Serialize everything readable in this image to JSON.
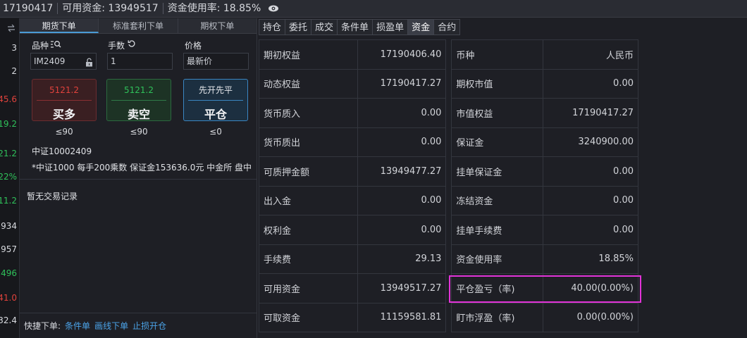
{
  "topbar": {
    "account": "17190417",
    "available_funds": "可用资金: 13949517",
    "usage_rate": "资金使用率: 18.85%",
    "visibility_icon": "eye-icon"
  },
  "left_column": {
    "header_icon": "swap-arrows-icon",
    "values": [
      {
        "text": "3",
        "color": "#d9dbe0"
      },
      {
        "text": "2",
        "color": "#d9dbe0"
      },
      {
        "text": "45.6",
        "color": "#e0423c"
      },
      {
        "text": "19.2",
        "color": "#2fc05a"
      },
      {
        "text": "21.2",
        "color": "#2fc05a"
      },
      {
        "text": "22%",
        "color": "#2fc05a"
      },
      {
        "text": "11.2",
        "color": "#2fc05a"
      },
      {
        "text": "934",
        "color": "#d9dbe0"
      },
      {
        "text": "957",
        "color": "#d9dbe0"
      },
      {
        "text": "496",
        "color": "#2fc05a"
      },
      {
        "text": "41.0",
        "color": "#e0423c"
      },
      {
        "text": "32.4",
        "color": "#d9dbe0"
      }
    ]
  },
  "order_panel": {
    "tabs": [
      {
        "label": "期货下单",
        "active": true
      },
      {
        "label": "标准套利下单",
        "active": false
      },
      {
        "label": "期权下单",
        "active": false
      }
    ],
    "variety_label": "品种",
    "variety_value": "IM2409",
    "lots_label": "手数",
    "lots_value": "1",
    "price_label": "价格",
    "price_value": "最新价",
    "buy": {
      "price": "5121.2",
      "action": "买多",
      "limit": "≤90",
      "color": "#e0423c"
    },
    "sell": {
      "price": "5121.2",
      "action": "卖空",
      "limit": "≤90",
      "color": "#2fc05a"
    },
    "close": {
      "price": "先开先平",
      "action": "平仓",
      "limit": "≤0"
    },
    "contract_name": "中证10002409",
    "contract_desc": "*中证1000 每手200乘数 保证金153636.0元 中金所 盘中",
    "no_records": "暂无交易记录",
    "quick_order_label": "快捷下单:",
    "quick_links": [
      "条件单",
      "画线下单",
      "止损开仓"
    ]
  },
  "right_tabs": [
    {
      "label": "持仓",
      "active": false
    },
    {
      "label": "委托",
      "active": false
    },
    {
      "label": "成交",
      "active": false
    },
    {
      "label": "条件单",
      "active": false
    },
    {
      "label": "损盈单",
      "active": false
    },
    {
      "label": "资金",
      "active": true
    },
    {
      "label": "合约",
      "active": false
    }
  ],
  "capital": {
    "rows": [
      [
        "期初权益",
        "17190406.40",
        "币种",
        "人民币"
      ],
      [
        "动态权益",
        "17190417.27",
        "期权市值",
        "0.00"
      ],
      [
        "货币质入",
        "0.00",
        "市值权益",
        "17190417.27"
      ],
      [
        "货币质出",
        "0.00",
        "保证金",
        "3240900.00"
      ],
      [
        "可质押金额",
        "13949477.27",
        "挂单保证金",
        "0.00"
      ],
      [
        "出入金",
        "0.00",
        "冻结资金",
        "0.00"
      ],
      [
        "权利金",
        "0.00",
        "挂单手续费",
        "0.00"
      ],
      [
        "手续费",
        "29.13",
        "资金使用率",
        "18.85%"
      ],
      [
        "可用资金",
        "13949517.27",
        "平仓盈亏（率)",
        "40.00(0.00%)"
      ],
      [
        "可取资金",
        "11159581.81",
        "盯市浮盈（率)",
        "0.00(0.00%)"
      ]
    ]
  }
}
